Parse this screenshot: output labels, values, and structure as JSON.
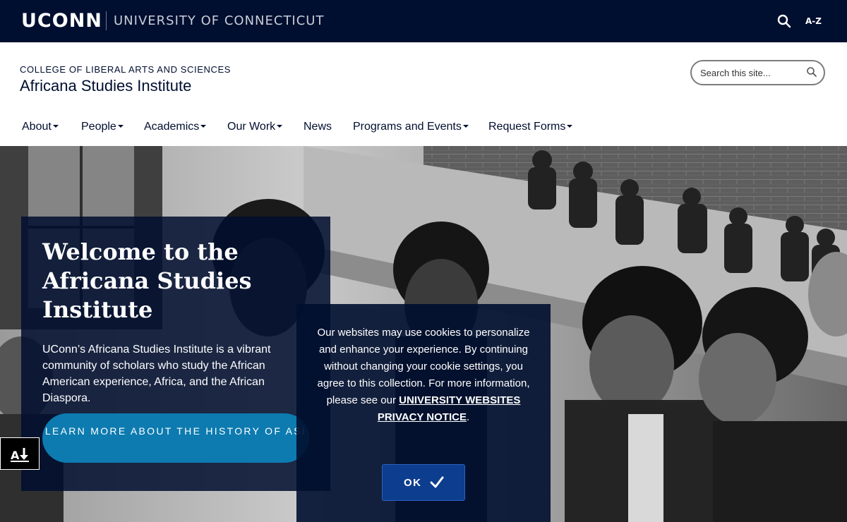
{
  "topbar": {
    "logo_text": "UCONN",
    "university_name": "UNIVERSITY OF CONNECTICUT",
    "search_icon": "search-icon",
    "az_label": "A-Z",
    "background": "#000e2f"
  },
  "header": {
    "college": "COLLEGE OF LIBERAL ARTS AND SCIENCES",
    "site_title": "Africana Studies Institute",
    "search_placeholder": "Search this site...",
    "search_icon": "search-icon"
  },
  "nav": {
    "items": [
      {
        "label": "About",
        "dropdown": true
      },
      {
        "label": "People",
        "dropdown": true
      },
      {
        "label": "Academics",
        "dropdown": true
      },
      {
        "label": "Our Work",
        "dropdown": true
      },
      {
        "label": "News",
        "dropdown": false
      },
      {
        "label": "Programs and Events",
        "dropdown": true
      },
      {
        "label": "Request Forms",
        "dropdown": true
      }
    ]
  },
  "hero": {
    "title": "Welcome to the Africana Studies Institute",
    "body": "UConn’s Africana Studies Institute is a vibrant community of scholars who study the African American experience, Africa, and the African Diaspora.",
    "cta_label": "LEARN MORE ABOUT THE HISTORY OF ASI",
    "cta_color": "#0d7bb0",
    "panel_color": "#000e2f"
  },
  "accessibility": {
    "icon": "accessibility-download-icon"
  },
  "cookie": {
    "text_before": "Our websites may use cookies to personalize and enhance your experience. By continuing without changing your cookie settings, you agree to this collection. For more information, please see our ",
    "link_label": "UNIVERSITY WEBSITES PRIVACY NOTICE",
    "text_after": ".",
    "ok_label": "OK",
    "ok_icon": "check-icon",
    "ok_color": "#0d3d8e"
  }
}
